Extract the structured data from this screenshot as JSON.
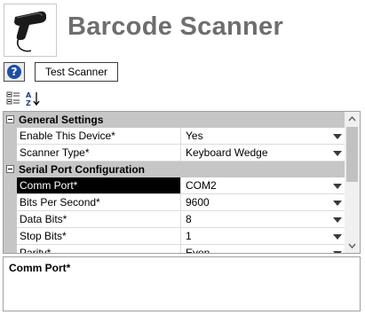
{
  "header": {
    "title": "Barcode Scanner",
    "device_icon": "barcode-scanner-image"
  },
  "actions": {
    "help_label": "?",
    "test_scanner_label": "Test Scanner"
  },
  "toolbar": {
    "categorized_icon": "categorized-view-icon",
    "alphabetical_icon": "alphabetical-sort-icon"
  },
  "property_grid": {
    "categories": [
      {
        "label": "General Settings",
        "properties": [
          {
            "name": "Enable This Device*",
            "value": "Yes"
          },
          {
            "name": "Scanner Type*",
            "value": "Keyboard Wedge"
          }
        ]
      },
      {
        "label": "Serial Port Configuration",
        "properties": [
          {
            "name": "Comm Port*",
            "value": "COM2",
            "selected": true
          },
          {
            "name": "Bits Per Second*",
            "value": "9600"
          },
          {
            "name": "Data Bits*",
            "value": "8"
          },
          {
            "name": "Stop Bits*",
            "value": "1"
          },
          {
            "name": "Parity*",
            "value": "Even"
          }
        ]
      }
    ]
  },
  "description": {
    "title": "Comm Port*"
  },
  "colors": {
    "title_text": "#6e6e6e",
    "category_background": "#c6c6c6",
    "selected_row_background": "#000000",
    "help_icon": "#1f4fa3"
  }
}
